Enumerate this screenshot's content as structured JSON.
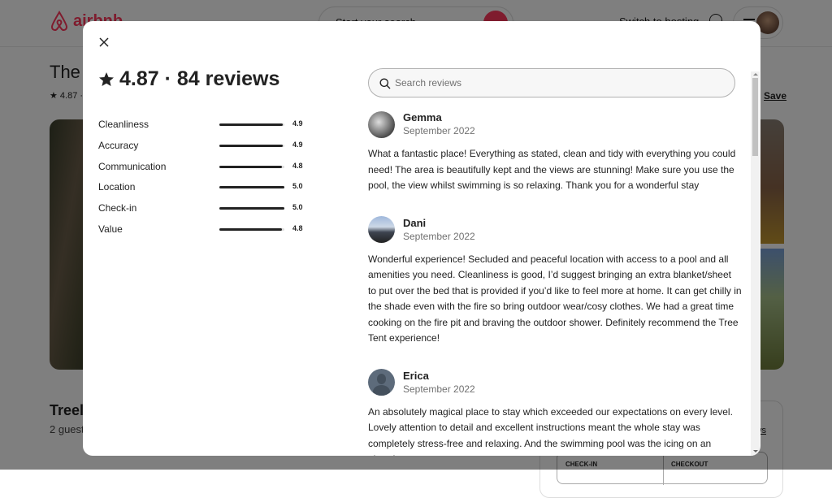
{
  "background": {
    "brand": "airbnb",
    "brand_color": "#ff385c",
    "search_placeholder": "Start your search",
    "switch_hosting": "Switch to hosting",
    "listing_title": "The",
    "listing_rating": "4.87 ·",
    "save_label": "Save",
    "listing_type": "Treel",
    "guests": "2 guest",
    "reviews_link": "ws",
    "checkin_label": "CHECK-IN",
    "checkout_label": "CHECKOUT"
  },
  "modal": {
    "summary": "4.87 · 84 reviews",
    "overall_rating": 4.87,
    "review_count": 84,
    "categories": [
      {
        "label": "Cleanliness",
        "value": "4.9",
        "fraction": 0.98
      },
      {
        "label": "Accuracy",
        "value": "4.9",
        "fraction": 0.98
      },
      {
        "label": "Communication",
        "value": "4.8",
        "fraction": 0.96
      },
      {
        "label": "Location",
        "value": "5.0",
        "fraction": 1.0
      },
      {
        "label": "Check-in",
        "value": "5.0",
        "fraction": 1.0
      },
      {
        "label": "Value",
        "value": "4.8",
        "fraction": 0.96
      }
    ],
    "search_placeholder": "Search reviews",
    "search_value": "",
    "reviews": [
      {
        "name": "Gemma",
        "date": "September 2022",
        "text": "What a fantastic place! Everything as stated, clean and tidy with everything you could need! The area is beautifully kept and the views are stunning! Make sure you use the pool, the view whilst swimming is so relaxing. Thank you for a wonderful stay"
      },
      {
        "name": "Dani",
        "date": "September 2022",
        "text": "Wonderful experience! Secluded and peaceful location with access to a pool and all amenities you need. Cleanliness is good, I’d suggest bringing an extra blanket/sheet to put over the bed that is provided if you’d like to feel more at home. It can get chilly in the shade even with the fire so bring outdoor wear/cosy clothes. We had a great time cooking on the fire pit and braving the outdoor shower. Definitely recommend the Tree Tent experience!"
      },
      {
        "name": "Erica",
        "date": "September 2022",
        "text": "An absolutely magical place to stay which exceeded our expectations on every level. Lovely attention to detail and excellent instructions meant the whole stay was completely stress-free and relaxing. And the swimming pool was the icing on an already"
      }
    ]
  }
}
